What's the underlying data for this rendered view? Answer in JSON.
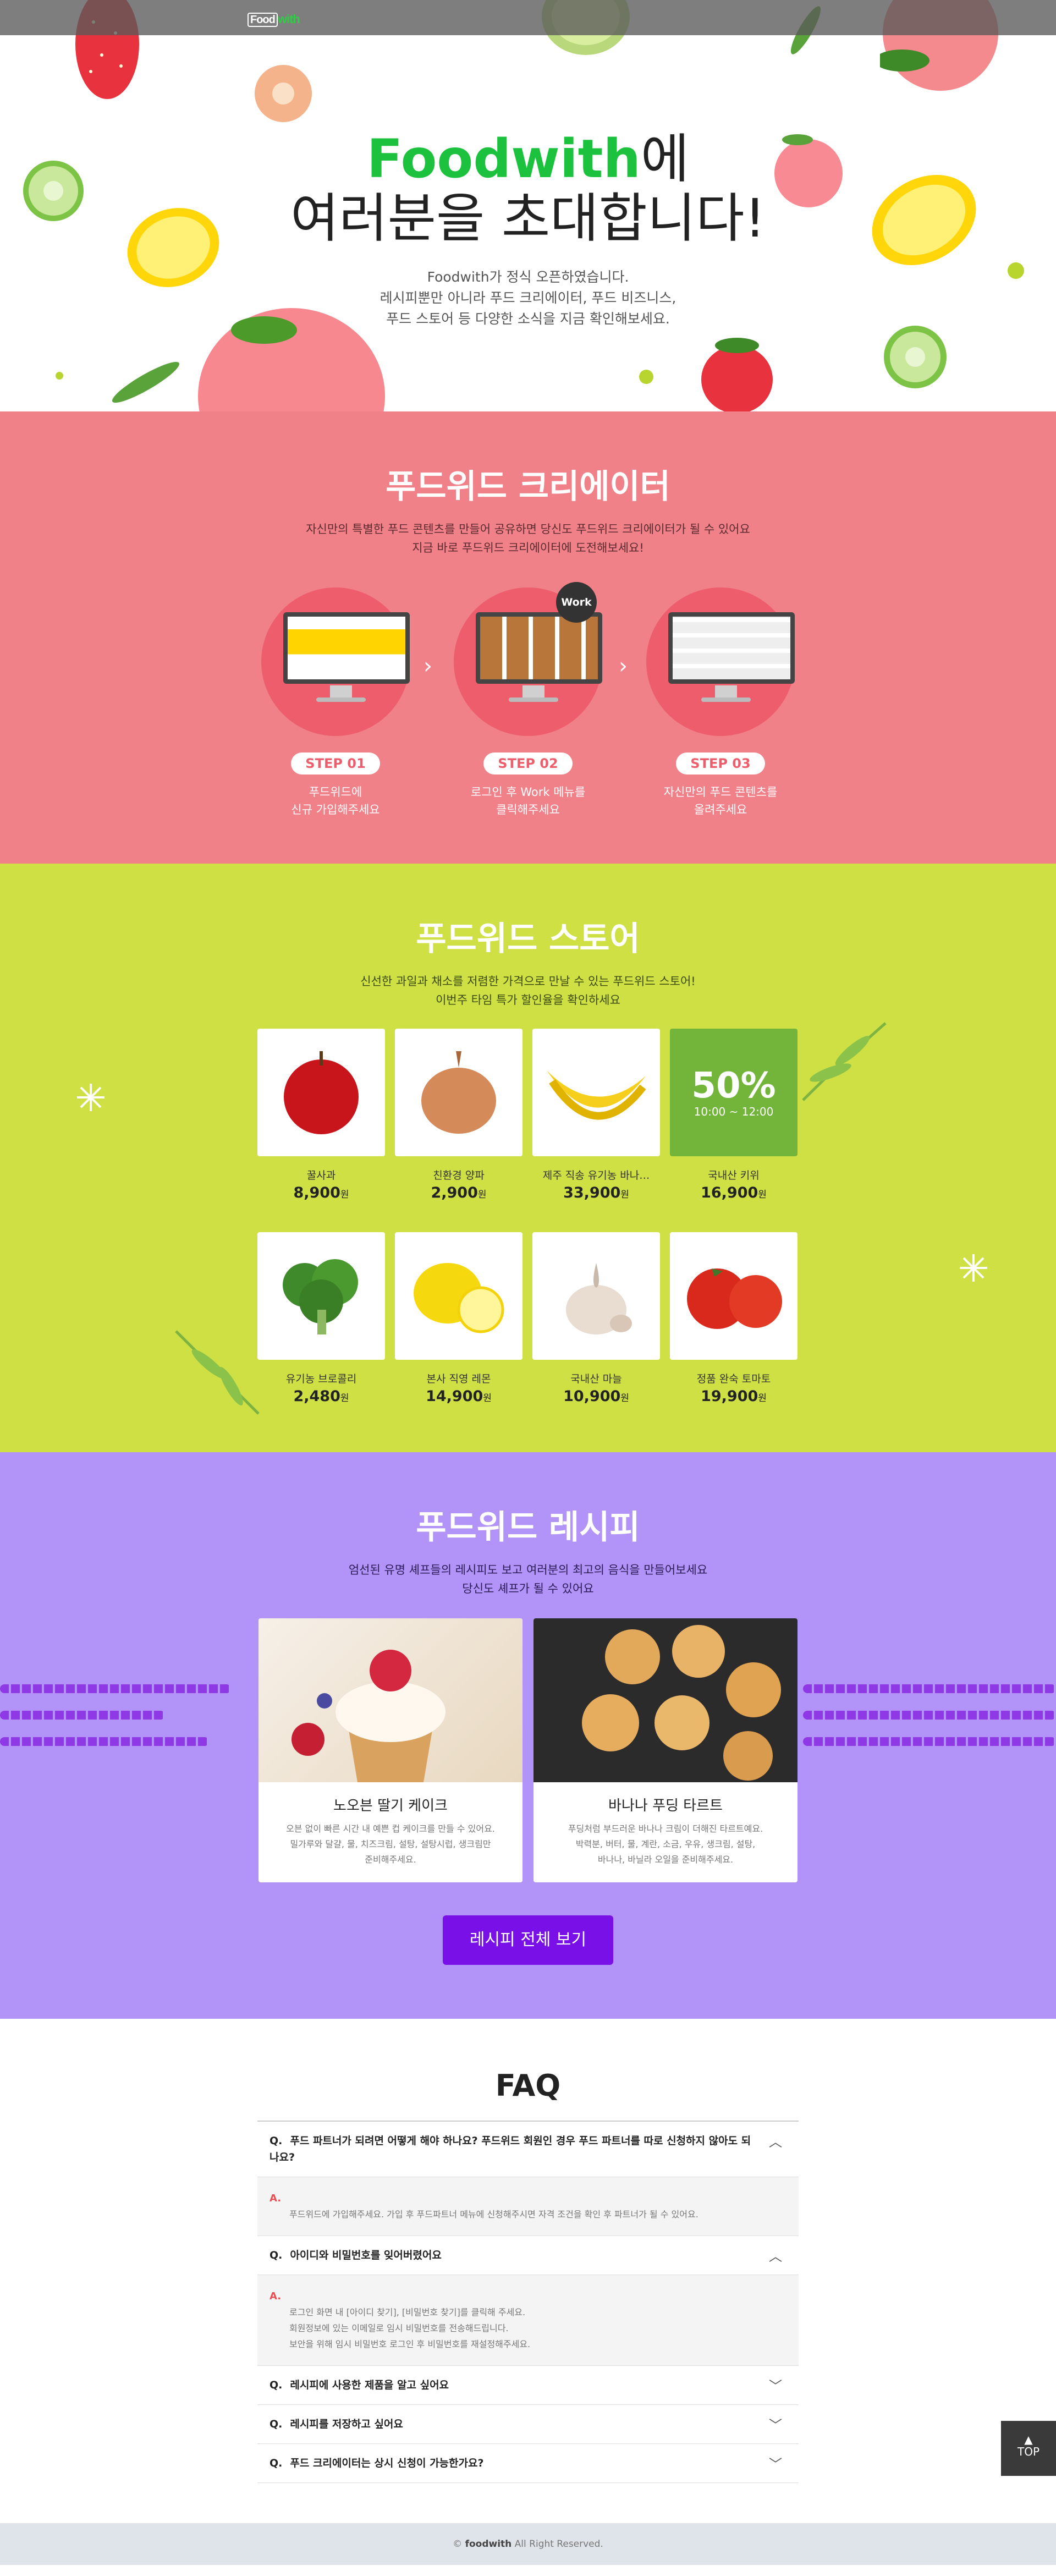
{
  "header": {
    "logo_a": "Food",
    "logo_b": "with"
  },
  "hero": {
    "brand": "Foodwith",
    "title_suffix": "에",
    "title_line2": "여러분을 초대합니다!",
    "description": "Foodwith가 정식 오픈하였습니다.\n레시피뿐만 아니라  푸드 크리에이터, 푸드 비즈니스,\n푸드 스토어 등 다양한 소식을 지금 확인해보세요."
  },
  "creator": {
    "title": "푸드위드 크리에이터",
    "description": "자신만의 특별한 푸드 콘텐츠를 만들어 공유하면 당신도 푸드위드 크리에이터가 될 수 있어요\n지금 바로 푸드위드 크리에이터에 도전해보세요!",
    "work_badge": "Work",
    "steps": [
      {
        "badge": "STEP 01",
        "text": "푸드위드에\n신규 가입해주세요"
      },
      {
        "badge": "STEP 02",
        "text": "로그인 후 Work 메뉴를\n클릭해주세요"
      },
      {
        "badge": "STEP 03",
        "text": "자신만의 푸드 콘텐츠를\n올려주세요"
      }
    ]
  },
  "store": {
    "title": "푸드위드 스토어",
    "description": "신선한 과일과 채소를 저렴한 가격으로 만날 수 있는 푸드위드 스토어!\n이번주 타임 특가 할인율을 확인하세요",
    "currency": "원",
    "sale": {
      "percent": "50%",
      "time": "10:00 ~ 12:00"
    },
    "products": [
      {
        "name": "꿀사과",
        "price": "8,900",
        "icon": "apple"
      },
      {
        "name": "친환경 양파",
        "price": "2,900",
        "icon": "onion"
      },
      {
        "name": "제주 직송 유기농 바나…",
        "price": "33,900",
        "icon": "banana"
      },
      {
        "name": "국내산 키위",
        "price": "16,900",
        "icon": "sale"
      },
      {
        "name": "유기농 브로콜리",
        "price": "2,480",
        "icon": "broccoli"
      },
      {
        "name": "본사 직영 레몬",
        "price": "14,900",
        "icon": "lemon"
      },
      {
        "name": "국내산 마늘",
        "price": "10,900",
        "icon": "garlic"
      },
      {
        "name": "정품 완숙 토마토",
        "price": "19,900",
        "icon": "tomato"
      }
    ]
  },
  "recipe": {
    "title": "푸드위드 레시피",
    "description": "엄선된 유명 셰프들의 레시피도 보고 여러분의 최고의 음식을 만들어보세요\n당신도 셰프가 될 수 있어요",
    "cards": [
      {
        "name": "노오븐 딸기 케이크",
        "description": "오븐 없이 빠른 시간 내 예쁜 컵 케이크를 만들 수 있어요.\n밀가루와 달걀, 물, 치즈크림, 설탕, 설탕시럽, 생크림만\n준비해주세요."
      },
      {
        "name": "바나나 푸딩 타르트",
        "description": "푸딩처럼 부드러운 바나나 크림이 더해진 타르트예요.\n박력분, 버터, 물, 계란, 소금, 우유, 생크림, 설탕,\n바나나, 바닐라 오일을 준비해주세요."
      }
    ],
    "button": "레시피 전체 보기"
  },
  "faq": {
    "title": "FAQ",
    "q_mark": "Q.",
    "a_mark": "A.",
    "items": [
      {
        "q": "푸드 파트너가 되려면 어떻게 해야 하나요? 푸드위드 회원인 경우 푸드 파트너를 따로 신청하지 않아도 되나요?",
        "a": "푸드위드에 가입해주세요. 가입 후 푸드파트너 메뉴에 신청해주시면 자격 조건을 확인 후 파트너가 될 수 있어요.",
        "open": true
      },
      {
        "q": "아이디와 비밀번호를 잊어버렸어요",
        "a": "로그인 화면 내 [아이디 찾기], [비밀번호 찾기]를 클릭해 주세요.\n회원정보에 있는 이메일로 임시 비밀번호를 전송해드립니다.\n보안을 위해 임시 비밀번호 로그인 후 비밀번호를 재설정해주세요.",
        "open": true
      },
      {
        "q": "레시피에 사용한 제품을 알고 싶어요",
        "open": false
      },
      {
        "q": "레시피를 저장하고 싶어요",
        "open": false
      },
      {
        "q": "푸드 크리에이터는 상시 신청이 가능한가요?",
        "open": false
      }
    ]
  },
  "top_button": "TOP",
  "footer": {
    "copy": "©",
    "brand": "foodwith",
    "rights": "All Right Reserved."
  },
  "colors": {
    "creator_bg": "#f08189",
    "store_bg": "#cfe045",
    "recipe_bg": "#b293f8",
    "brand_green": "#1cc23d",
    "button_purple": "#7a10e8"
  }
}
